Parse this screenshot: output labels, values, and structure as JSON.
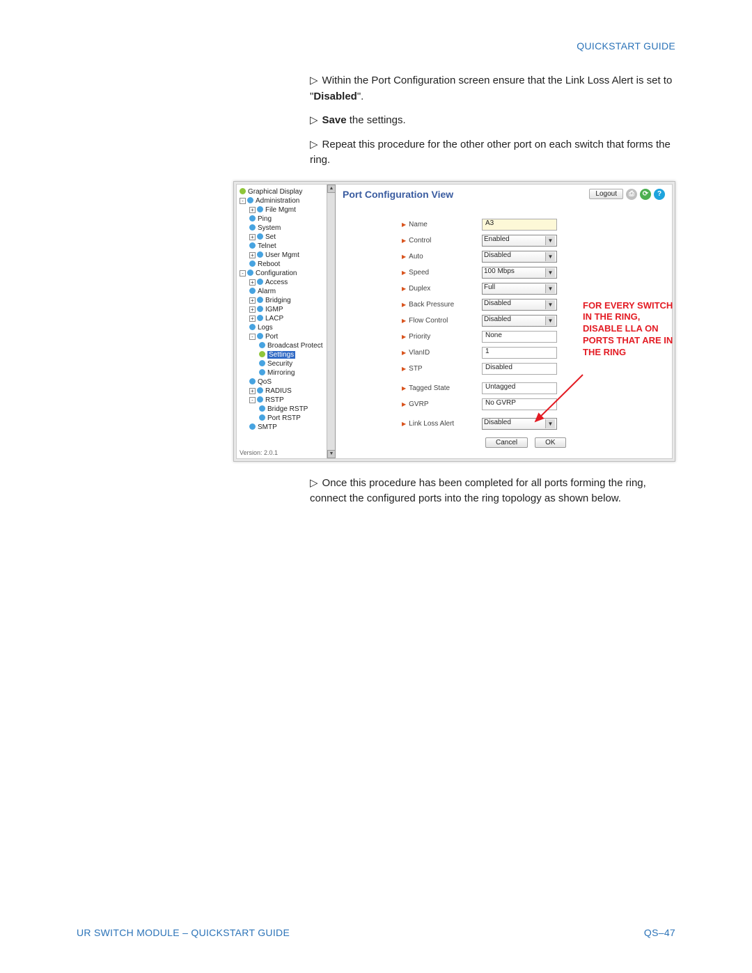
{
  "header": {
    "title": "QUICKSTART GUIDE"
  },
  "instructions": {
    "i1a": "Within the Port Configuration screen ensure that  the Link Loss Alert is set to \"",
    "i1_bold": "Disabled",
    "i1b": "\".",
    "i2_bold": "Save",
    "i2_rest": " the settings.",
    "i3": "Repeat this procedure for the other other port on each switch that forms the ring."
  },
  "tree": {
    "version": "Version: 2.0.1",
    "items": {
      "graphical": "Graphical Display",
      "administration": "Administration",
      "filemgmt": "File Mgmt",
      "ping": "Ping",
      "system": "System",
      "set": "Set",
      "telnet": "Telnet",
      "usermgmt": "User Mgmt",
      "reboot": "Reboot",
      "configuration": "Configuration",
      "access": "Access",
      "alarm": "Alarm",
      "bridging": "Bridging",
      "igmp": "IGMP",
      "lacp": "LACP",
      "logs": "Logs",
      "port": "Port",
      "broadcast": "Broadcast Protect",
      "settings": "Settings",
      "security": "Security",
      "mirroring": "Mirroring",
      "qos": "QoS",
      "radius": "RADIUS",
      "rstp": "RSTP",
      "bridgerstp": "Bridge RSTP",
      "portrstp": "Port RSTP",
      "smtp": "SMTP"
    }
  },
  "panel": {
    "title": "Port Configuration View",
    "logout": "Logout",
    "rows": {
      "name": {
        "label": "Name",
        "value": "A3"
      },
      "control": {
        "label": "Control",
        "value": "Enabled"
      },
      "auto": {
        "label": "Auto",
        "value": "Disabled"
      },
      "speed": {
        "label": "Speed",
        "value": "100 Mbps"
      },
      "duplex": {
        "label": "Duplex",
        "value": "Full"
      },
      "backp": {
        "label": "Back Pressure",
        "value": "Disabled"
      },
      "flow": {
        "label": "Flow Control",
        "value": "Disabled"
      },
      "priority": {
        "label": "Priority",
        "value": "None"
      },
      "vlan": {
        "label": "VlanID",
        "value": "1"
      },
      "stp": {
        "label": "STP",
        "value": "Disabled"
      },
      "tagged": {
        "label": "Tagged State",
        "value": "Untagged"
      },
      "gvrp": {
        "label": "GVRP",
        "value": "No GVRP"
      },
      "lla": {
        "label": "Link Loss Alert",
        "value": "Disabled"
      }
    },
    "buttons": {
      "cancel": "Cancel",
      "ok": "OK"
    }
  },
  "annotation": "FOR EVERY SWITCH IN THE RING, DISABLE LLA ON PORTS THAT ARE IN THE RING",
  "after": "Once this procedure has been completed for all ports forming the ring, connect the configured ports into the ring topology as shown below.",
  "footer": {
    "left": "UR SWITCH MODULE – QUICKSTART GUIDE",
    "right": "QS–47"
  }
}
